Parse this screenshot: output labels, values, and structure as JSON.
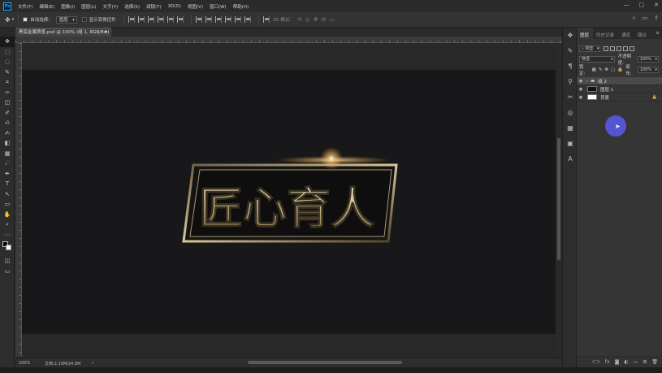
{
  "app": {
    "logo": "Ps"
  },
  "menu": [
    "文件(F)",
    "编辑(E)",
    "图像(I)",
    "图层(L)",
    "文字(Y)",
    "选择(S)",
    "滤镜(T)",
    "3D(D)",
    "视图(V)",
    "窗口(W)",
    "帮助(H)"
  ],
  "window_controls": {
    "minimize": "—",
    "maximize": "▢",
    "close": "✕"
  },
  "options": {
    "auto_select_label": "自动选择：",
    "auto_select_value": "图层",
    "show_transform_label": "显示变换控件",
    "mode3d_label": "3D 模式：",
    "right_icons": [
      "⌕",
      "▭",
      "⇧"
    ]
  },
  "tools": [
    "✥",
    "⬚",
    "◌",
    "✎",
    "⌗",
    "✑",
    "◫",
    "✐",
    "⎌",
    "✍",
    "◧",
    "▦",
    "☄",
    "✒",
    "T",
    "↖",
    "▭",
    "✋",
    "⌕",
    "⋯"
  ],
  "document": {
    "tab_label": "黑底金属质感.psd @ 100% (组 1, RGB/8#) *",
    "close": "×"
  },
  "artwork": {
    "text": "匠心育人"
  },
  "status": {
    "zoom": "100%",
    "doc_info": "文档:3.33M/24.5M",
    "arrow": "›"
  },
  "dock_icons": [
    "❖",
    "✎",
    "¶",
    "⚲",
    "✂",
    "◎",
    "▦",
    "▣",
    "A"
  ],
  "panel": {
    "tabs": [
      "图层",
      "历史记录",
      "通道",
      "路径"
    ],
    "menu": "≡",
    "filter_kind": "类型",
    "blend_mode": "穿透",
    "opacity_label": "不透明度:",
    "opacity_value": "100%",
    "lock_label": "锁定:",
    "fill_label": "填充:",
    "fill_value": "100%",
    "layers": [
      {
        "name": "组 2",
        "type": "group",
        "selected": true
      },
      {
        "name": "图层 1",
        "type": "layer",
        "selected": false
      },
      {
        "name": "背景",
        "type": "background",
        "selected": false,
        "locked": true
      }
    ],
    "footer_icons": [
      "⊂⊃",
      "fx",
      "◙",
      "◐",
      "▭",
      "⊞",
      "🗑"
    ]
  },
  "colors": {
    "accent": "#31a8ff",
    "cursor": "#5a5af0",
    "gold": "#d8c9a0"
  }
}
